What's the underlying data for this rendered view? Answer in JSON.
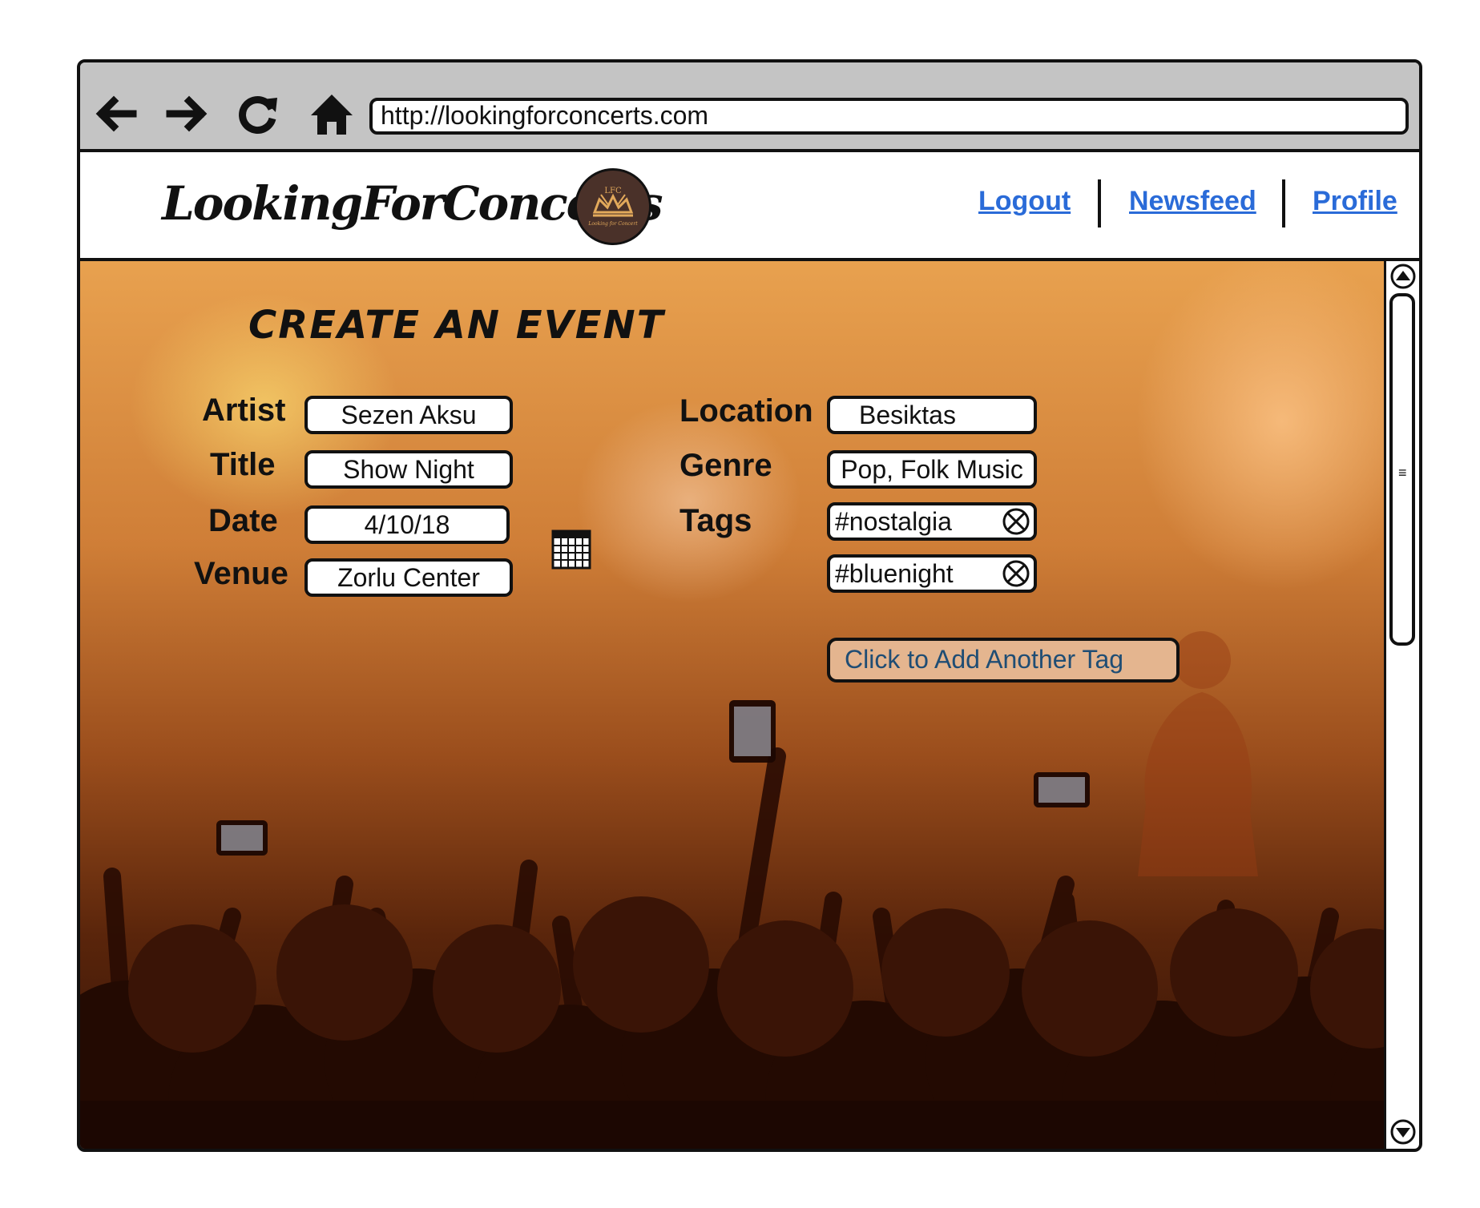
{
  "browser": {
    "url": "http://lookingforconcerts.com"
  },
  "header": {
    "brand": "LookingForConcerts",
    "logo_text": "LFC",
    "logo_subtext": "Looking for Concert",
    "nav": {
      "logout": "Logout",
      "newsfeed": "Newsfeed",
      "profile": "Profile"
    }
  },
  "form": {
    "title": "CREATE AN EVENT",
    "artist": {
      "label": "Artist",
      "value": "Sezen Aksu"
    },
    "event_title": {
      "label": "Title",
      "value": "Show Night"
    },
    "date": {
      "label": "Date",
      "value": "4/10/18"
    },
    "venue": {
      "label": "Venue",
      "value": "Zorlu Center"
    },
    "location": {
      "label": "Location",
      "value": "Besiktas"
    },
    "genre": {
      "label": "Genre",
      "value": "Pop, Folk Music"
    },
    "tags": {
      "label": "Tags",
      "items": [
        "#nostalgia",
        "#bluenight"
      ],
      "add_button": "Click to Add Another Tag"
    }
  },
  "colors": {
    "link": "#2a6bd8",
    "add_button_bg": "#e4b58f",
    "add_button_text": "#1f4d74",
    "logo_bg": "#4a3129",
    "chrome_bg": "#c4c4c4"
  },
  "icons": [
    "back-arrow-icon",
    "forward-arrow-icon",
    "reload-icon",
    "home-icon",
    "calendar-icon",
    "remove-tag-icon",
    "scroll-up-icon",
    "scroll-down-icon"
  ]
}
